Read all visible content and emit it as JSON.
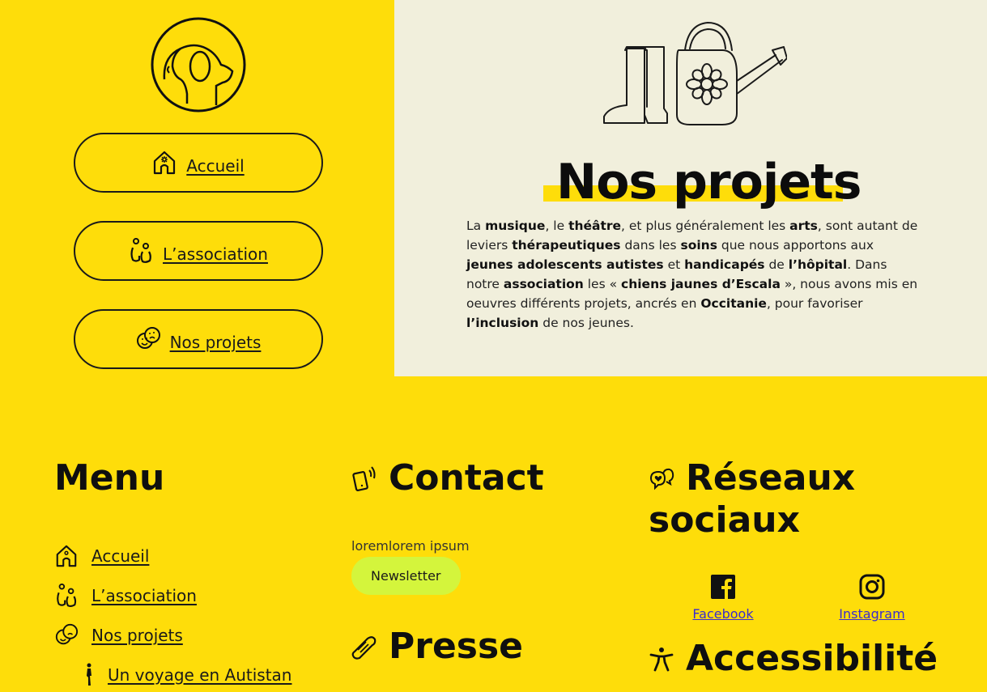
{
  "nav": {
    "items": [
      {
        "label": "Accueil",
        "icon": "house-flower-icon"
      },
      {
        "label": "L’association",
        "icon": "people-icon"
      },
      {
        "label": "Nos projets",
        "icon": "theater-masks-icon"
      }
    ]
  },
  "hero": {
    "title": "Nos projets",
    "illustration": "boots-and-watering-can-illustration",
    "paragraph_html": "La <b>musique</b>, le <b>théâtre</b>, et plus généralement les <b>arts</b>, sont autant de leviers <b>thérapeutiques</b> dans les <b>soins</b> que nous apportons aux <b>jeunes adolescents autistes</b> et <b>handicapés</b> de <b>l’hôpital</b>. Dans notre <b>association</b> les «  <b>chiens jaunes d’Escala</b> », nous avons mis en oeuvres différents projets, ancrés en <b>Occitanie</b>, pour favoriser <b>l’inclusion</b> de nos jeunes."
  },
  "footer": {
    "menu": {
      "title": "Menu",
      "items": [
        {
          "label": "Accueil",
          "icon": "house-flower-icon"
        },
        {
          "label": "L’association",
          "icon": "people-icon"
        },
        {
          "label": "Nos projets",
          "icon": "theater-masks-icon"
        }
      ],
      "sub_items": [
        {
          "label": "Un voyage en Autistan",
          "icon": "walking-person-icon"
        }
      ]
    },
    "contact": {
      "title": "Contact",
      "icon": "phone-icon",
      "text": "loremlorem ipsum",
      "newsletter_label": "Newsletter"
    },
    "presse": {
      "title": "Presse",
      "icon": "newspaper-roll-icon"
    },
    "social": {
      "title_line1": "Réseaux",
      "title_line2": "sociaux",
      "icon": "speech-bubbles-heart-icon",
      "links": [
        {
          "label": "Facebook",
          "icon": "facebook-icon"
        },
        {
          "label": "Instagram",
          "icon": "instagram-icon"
        }
      ]
    },
    "accessibility": {
      "title": "Accessibilité",
      "icon": "accessibility-person-icon"
    }
  },
  "colors": {
    "yellow": "#fedd0a",
    "cream": "#f1efdc",
    "newsletter_green": "#d4f53c",
    "link_blue": "#3a2bd0"
  }
}
